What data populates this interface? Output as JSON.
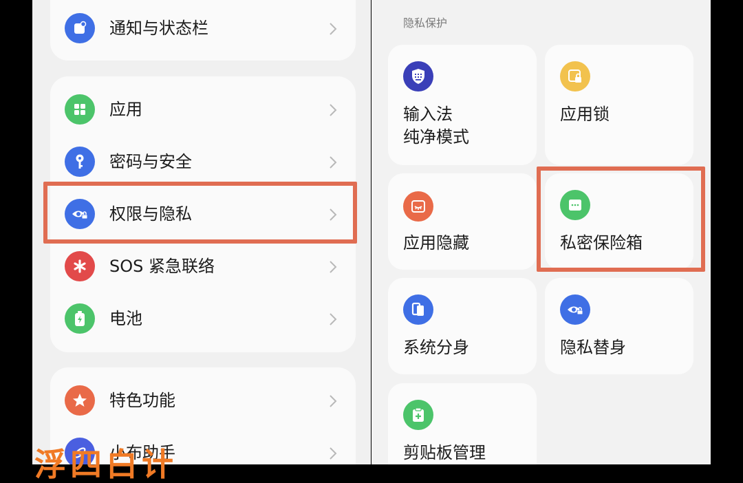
{
  "colors": {
    "highlight": "#e06d52",
    "blue": "#3f6fe5",
    "green": "#4cc46a",
    "red": "#e24a4a",
    "orange": "#e96a48",
    "yellow": "#f2c24e",
    "indigo": "#3a3fb8",
    "overlay_text": "#f07a25"
  },
  "left": {
    "groups": [
      {
        "items": [
          {
            "label": "通知与状态栏",
            "icon": "notification-icon"
          }
        ]
      },
      {
        "items": [
          {
            "label": "应用",
            "icon": "apps-grid-icon"
          },
          {
            "label": "密码与安全",
            "icon": "key-icon"
          },
          {
            "label": "权限与隐私",
            "icon": "eye-lock-icon"
          },
          {
            "label": "SOS 紧急联络",
            "icon": "asterisk-icon"
          },
          {
            "label": "电池",
            "icon": "battery-icon"
          }
        ]
      },
      {
        "items": [
          {
            "label": "特色功能",
            "icon": "star-icon"
          },
          {
            "label": "小布助手",
            "icon": "assistant-icon"
          }
        ]
      }
    ]
  },
  "right": {
    "section_title": "隐私保护",
    "tiles": [
      {
        "label_line1": "输入法",
        "label_line2": "纯净模式",
        "icon": "keyboard-shield-icon"
      },
      {
        "label_line1": "应用锁",
        "icon": "app-lock-icon"
      },
      {
        "label_line1": "应用隐藏",
        "icon": "hidden-app-icon"
      },
      {
        "label_line1": "私密保险箱",
        "icon": "safe-box-icon"
      },
      {
        "label_line1": "系统分身",
        "icon": "clone-icon"
      },
      {
        "label_line1": "隐私替身",
        "icon": "privacy-double-icon"
      },
      {
        "label_line1": "剪贴板管理",
        "icon": "clipboard-icon"
      }
    ]
  },
  "overlay": {
    "caption_fragment": "浮四白计"
  }
}
